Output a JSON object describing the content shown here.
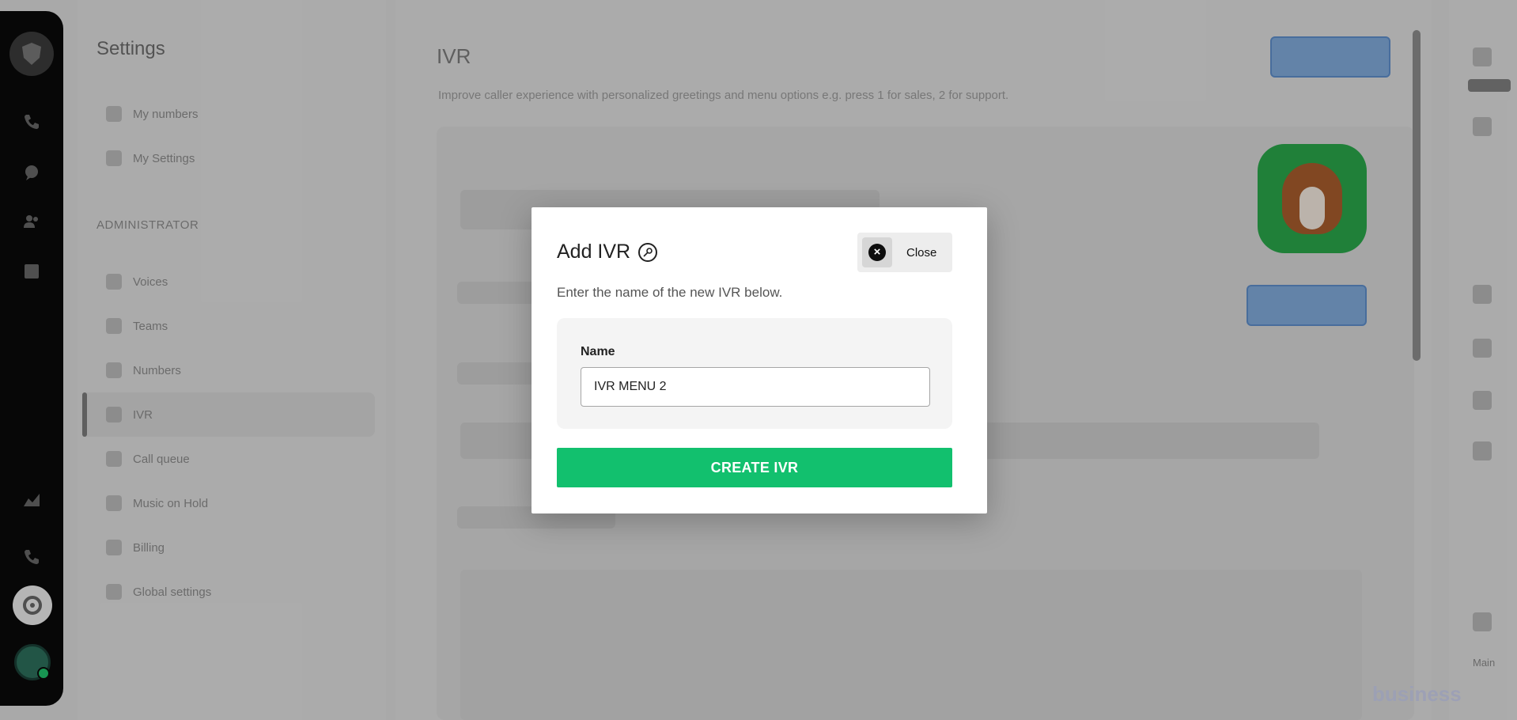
{
  "settings": {
    "title": "Settings",
    "items": [
      {
        "label": "My numbers"
      },
      {
        "label": "My Settings"
      }
    ],
    "admin_label": "ADMINISTRATOR",
    "admin_items": [
      {
        "label": "Voices"
      },
      {
        "label": "Teams"
      },
      {
        "label": "Numbers"
      },
      {
        "label": "IVR"
      },
      {
        "label": "Call queue"
      },
      {
        "label": "Music on Hold"
      },
      {
        "label": "Billing"
      },
      {
        "label": "Global settings"
      }
    ]
  },
  "main": {
    "title": "IVR",
    "description": "Improve caller experience with personalized greetings and menu options e.g. press 1 for sales, 2 for support."
  },
  "right_rail": {
    "bottom_label": "Main"
  },
  "watermark": "business",
  "modal": {
    "title": "Add IVR",
    "close_label": "Close",
    "subtitle": "Enter the name of the new IVR below.",
    "field_label": "Name",
    "field_value": "IVR MENU 2",
    "submit_label": "CREATE IVR"
  }
}
